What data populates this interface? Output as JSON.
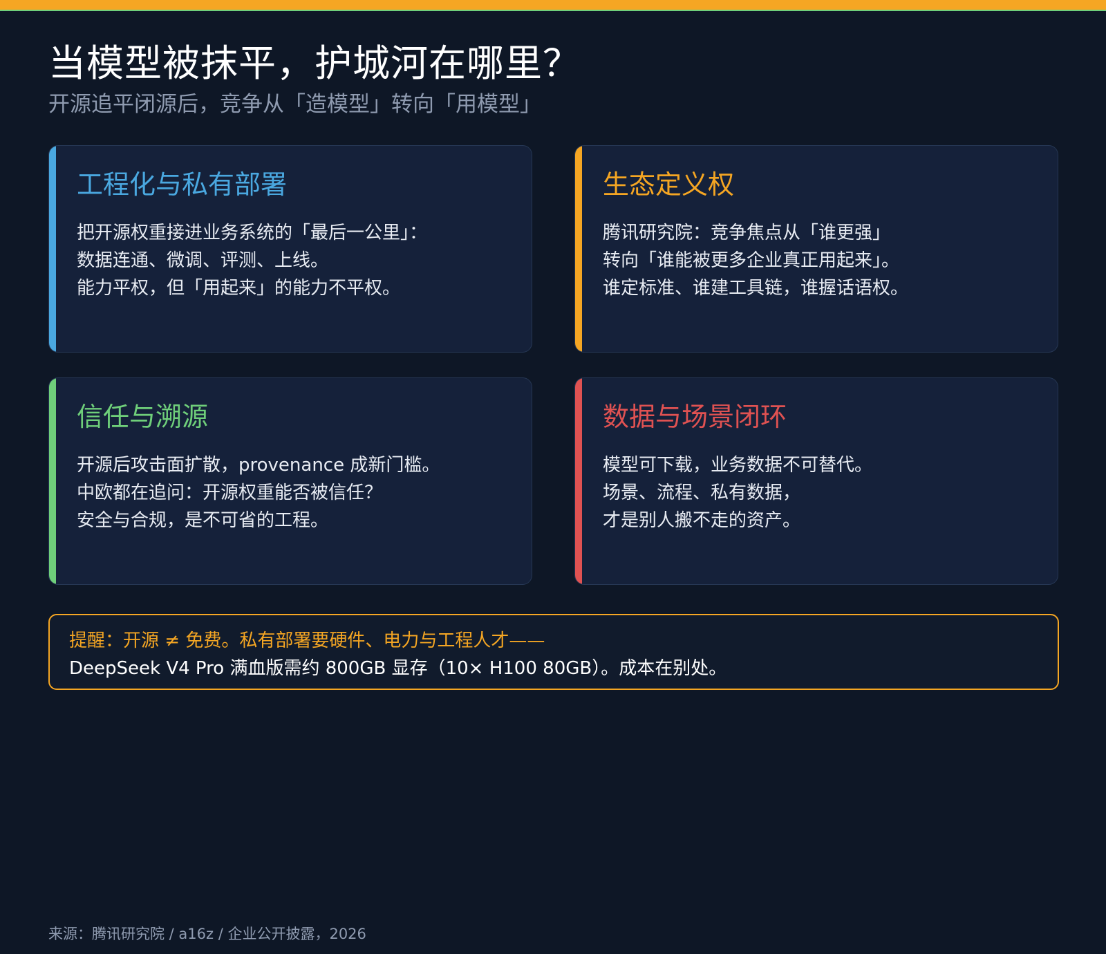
{
  "header": {
    "title": "当模型被抹平，护城河在哪里？",
    "subtitle": "开源追平闭源后，竞争从「造模型」转向「用模型」"
  },
  "colors": {
    "top_bar": "#f5a623",
    "top_bar_edge": "#6fcf7a",
    "blue": "#4aa8e0",
    "orange": "#f5a623",
    "green": "#6fcf7a",
    "red": "#e05252"
  },
  "cards": [
    {
      "title": "工程化与私有部署",
      "color": "#4aa8e0",
      "lines": [
        "把开源权重接进业务系统的「最后一公里」：",
        "数据连通、微调、评测、上线。",
        "能力平权，但「用起来」的能力不平权。"
      ]
    },
    {
      "title": "生态定义权",
      "color": "#f5a623",
      "lines": [
        "腾讯研究院：竞争焦点从「谁更强」",
        "转向「谁能被更多企业真正用起来」。",
        "谁定标准、谁建工具链，谁握话语权。"
      ]
    },
    {
      "title": "信任与溯源",
      "color": "#6fcf7a",
      "lines": [
        "开源后攻击面扩散，provenance 成新门槛。",
        "中欧都在追问：开源权重能否被信任？",
        "安全与合规，是不可省的工程。"
      ]
    },
    {
      "title": "数据与场景闭环",
      "color": "#e05252",
      "lines": [
        "模型可下载，业务数据不可替代。",
        "场景、流程、私有数据，",
        "才是别人搬不走的资产。"
      ]
    }
  ],
  "note": {
    "line1": "提醒：开源 ≠ 免费。私有部署要硬件、电力与工程人才——",
    "line2": "DeepSeek V4 Pro 满血版需约 800GB 显存（10× H100 80GB）。成本在别处。"
  },
  "footer": {
    "source": "来源：腾讯研究院 / a16z / 企业公开披露，2026"
  }
}
